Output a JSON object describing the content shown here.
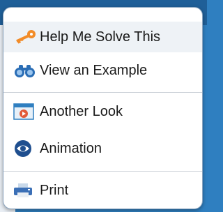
{
  "menu": {
    "items": [
      {
        "label": "Help Me Solve This",
        "icon": "key-icon"
      },
      {
        "label": "View an Example",
        "icon": "binoculars-icon"
      },
      {
        "label": "Another Look",
        "icon": "video-window-icon"
      },
      {
        "label": "Animation",
        "icon": "animation-eye-icon"
      },
      {
        "label": "Print",
        "icon": "printer-icon"
      }
    ]
  },
  "colors": {
    "key": "#f28c28",
    "binoculars": "#2a6db5",
    "animation": "#1f4f8f",
    "printer": "#3b6fb6"
  }
}
